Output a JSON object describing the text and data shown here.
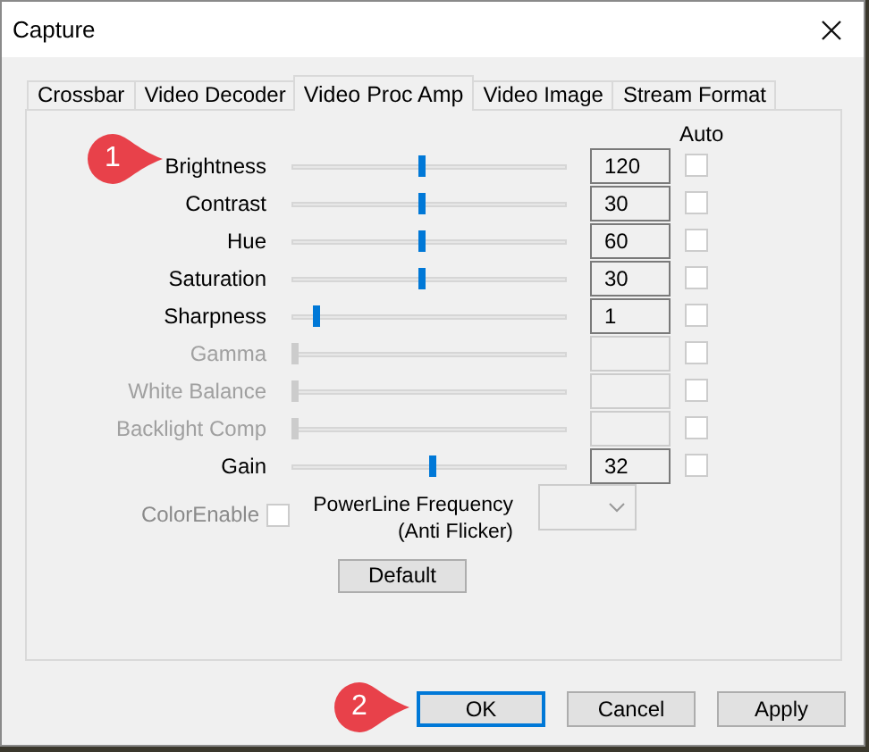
{
  "window": {
    "title": "Capture"
  },
  "tabs": [
    {
      "label": "Crossbar",
      "selected": false
    },
    {
      "label": "Video Decoder",
      "selected": false
    },
    {
      "label": "Video Proc Amp",
      "selected": true
    },
    {
      "label": "Video Image",
      "selected": false
    },
    {
      "label": "Stream Format",
      "selected": false
    }
  ],
  "auto_header": "Auto",
  "properties": [
    {
      "label": "Brightness",
      "disabled": false,
      "level": 0.47,
      "value": "120",
      "auto": false
    },
    {
      "label": "Contrast",
      "disabled": false,
      "level": 0.47,
      "value": "30",
      "auto": false
    },
    {
      "label": "Hue",
      "disabled": false,
      "level": 0.47,
      "value": "60",
      "auto": false
    },
    {
      "label": "Saturation",
      "disabled": false,
      "level": 0.47,
      "value": "30",
      "auto": false
    },
    {
      "label": "Sharpness",
      "disabled": false,
      "level": 0.08,
      "value": "1",
      "auto": false
    },
    {
      "label": "Gamma",
      "disabled": true,
      "level": 0,
      "auto": false
    },
    {
      "label": "White Balance",
      "disabled": true,
      "level": 0,
      "auto": false
    },
    {
      "label": "Backlight Comp",
      "disabled": true,
      "level": 0,
      "auto": false
    },
    {
      "label": "Gain",
      "disabled": false,
      "level": 0.51,
      "value": "32",
      "auto": false
    }
  ],
  "color_enable": {
    "label": "ColorEnable",
    "checked": false,
    "disabled": true
  },
  "powerline": {
    "label_lines": [
      "PowerLine Frequency",
      "(Anti Flicker)"
    ],
    "disabled": true
  },
  "default_button": "Default",
  "buttons": [
    {
      "label": "OK",
      "focused": true
    },
    {
      "label": "Cancel",
      "focused": false
    },
    {
      "label": "Apply",
      "focused": false
    }
  ],
  "callouts": [
    {
      "number": "1"
    },
    {
      "number": "2"
    }
  ]
}
